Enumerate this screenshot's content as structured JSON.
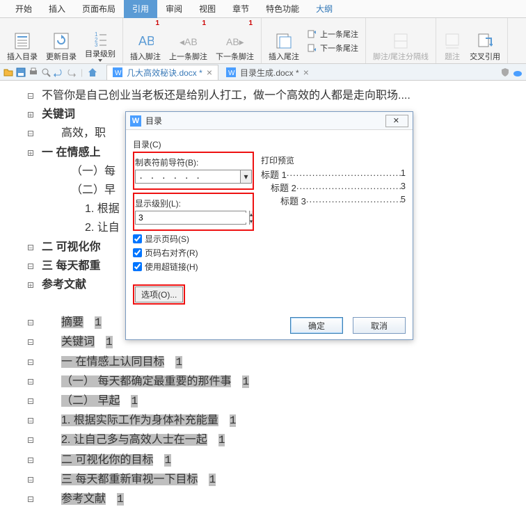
{
  "menu": {
    "items": [
      "开始",
      "插入",
      "页面布局",
      "引用",
      "审阅",
      "视图",
      "章节",
      "特色功能",
      "大纲"
    ],
    "active": 3,
    "highlight": 8
  },
  "ribbon": {
    "g1": [
      {
        "l": "插入目录"
      },
      {
        "l": "更新目录"
      },
      {
        "l": "目录级别"
      }
    ],
    "g2": [
      {
        "l": "插入脚注",
        "n": "1"
      },
      {
        "l": "上一条脚注",
        "n": "1"
      },
      {
        "l": "下一条脚注",
        "n": "1"
      }
    ],
    "g3": {
      "btn": "插入尾注",
      "up": "上一条尾注",
      "down": "下一条尾注"
    },
    "g4": "脚注/尾注分隔线",
    "g5": "题注",
    "g6": "交叉引用"
  },
  "tabs": {
    "t1": "几大高效秘诀.docx *",
    "t2": "目录生成.docx *"
  },
  "doc": {
    "l1": "不管你是自己创业当老板还是给别人打工，做一个高效的人都是走向职场....",
    "l2": "关键词",
    "l3": "高效，职",
    "l4": "一  在情感上",
    "l5": "（一）每",
    "l6": "（二）早",
    "l7": "1. 根据",
    "l8": "2. 让自",
    "l9": "二  可视化你",
    "l10": "三  每天都重",
    "l11": "参考文献",
    "toc": [
      {
        "t": "摘要",
        "n": "1"
      },
      {
        "t": "关键词",
        "n": "1"
      },
      {
        "t": "一  在情感上认同目标",
        "n": "1"
      },
      {
        "t": "（一）  每天都确定最重要的那件事",
        "n": "1"
      },
      {
        "t": "（二）  早起",
        "n": "1"
      },
      {
        "t": "1. 根据实际工作为身体补充能量",
        "n": "1"
      },
      {
        "t": "2. 让自己多与高效人士在一起",
        "n": "1"
      },
      {
        "t": "二  可视化你的目标",
        "n": "1"
      },
      {
        "t": "三  每天都重新审视一下目标",
        "n": "1"
      },
      {
        "t": "参考文献",
        "n": "1"
      }
    ]
  },
  "dlg": {
    "title": "目录",
    "heading": "目录(C)",
    "leader_label": "制表符前导符(B):",
    "leader_value": ". . . . . .",
    "level_label": "显示级别(L):",
    "level_value": "3",
    "c1": "显示页码(S)",
    "c2": "页码右对齐(R)",
    "c3": "使用超链接(H)",
    "options": "选项(O)...",
    "preview_label": "打印预览",
    "preview": [
      {
        "t": "标题 1",
        "p": "1"
      },
      {
        "t": "标题 2",
        "p": "3",
        "indent": 14
      },
      {
        "t": "标题 3",
        "p": "5",
        "indent": 28
      }
    ],
    "ok": "确定",
    "cancel": "取消"
  }
}
